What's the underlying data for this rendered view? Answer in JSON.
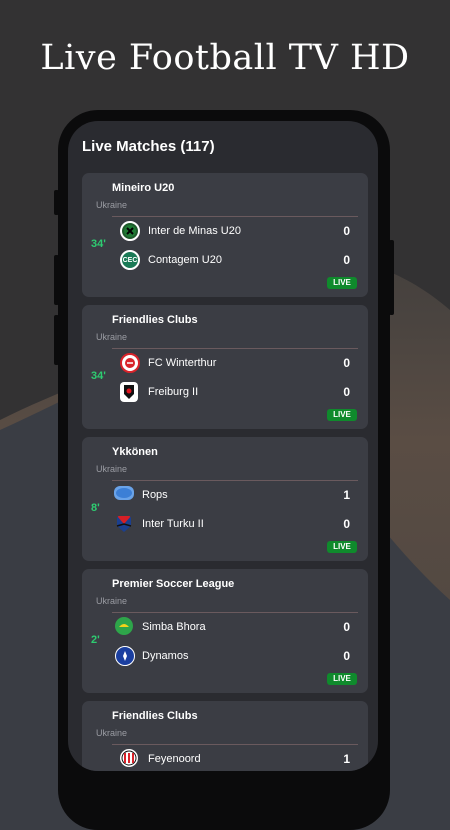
{
  "headline": "Live Football TV HD",
  "screen_title": "Live Matches (117)",
  "matches": [
    {
      "league": "Mineiro U20",
      "country": "Ukraine",
      "minute": "34'",
      "home": {
        "name": "Inter de Minas U20",
        "score": "0",
        "logo": "inter-de-minas-logo"
      },
      "away": {
        "name": "Contagem U20",
        "score": "0",
        "logo": "contagem-logo"
      },
      "status": "LIVE"
    },
    {
      "league": "Friendlies Clubs",
      "country": "Ukraine",
      "minute": "34'",
      "home": {
        "name": "FC Winterthur",
        "score": "0",
        "logo": "winterthur-logo"
      },
      "away": {
        "name": "Freiburg II",
        "score": "0",
        "logo": "freiburg-logo"
      },
      "status": "LIVE"
    },
    {
      "league": "Ykkönen",
      "country": "Ukraine",
      "minute": "8'",
      "home": {
        "name": "Rops",
        "score": "1",
        "logo": "rops-logo"
      },
      "away": {
        "name": "Inter Turku II",
        "score": "0",
        "logo": "inter-turku-logo"
      },
      "status": "LIVE"
    },
    {
      "league": "Premier Soccer League",
      "country": "Ukraine",
      "minute": "2'",
      "home": {
        "name": "Simba Bhora",
        "score": "0",
        "logo": "simba-bhora-logo"
      },
      "away": {
        "name": "Dynamos",
        "score": "0",
        "logo": "dynamos-logo"
      },
      "status": "LIVE"
    },
    {
      "league": "Friendlies Clubs",
      "country": "Ukraine",
      "minute": "",
      "home": {
        "name": "Feyenoord",
        "score": "1",
        "logo": "feyenoord-logo"
      },
      "away": {
        "name": "",
        "score": "",
        "logo": ""
      },
      "status": ""
    }
  ],
  "colors": {
    "accent_green": "#2ecc71",
    "live_badge": "#0f8a2c",
    "card": "#3b3d44",
    "screen": "#2a2b30"
  }
}
